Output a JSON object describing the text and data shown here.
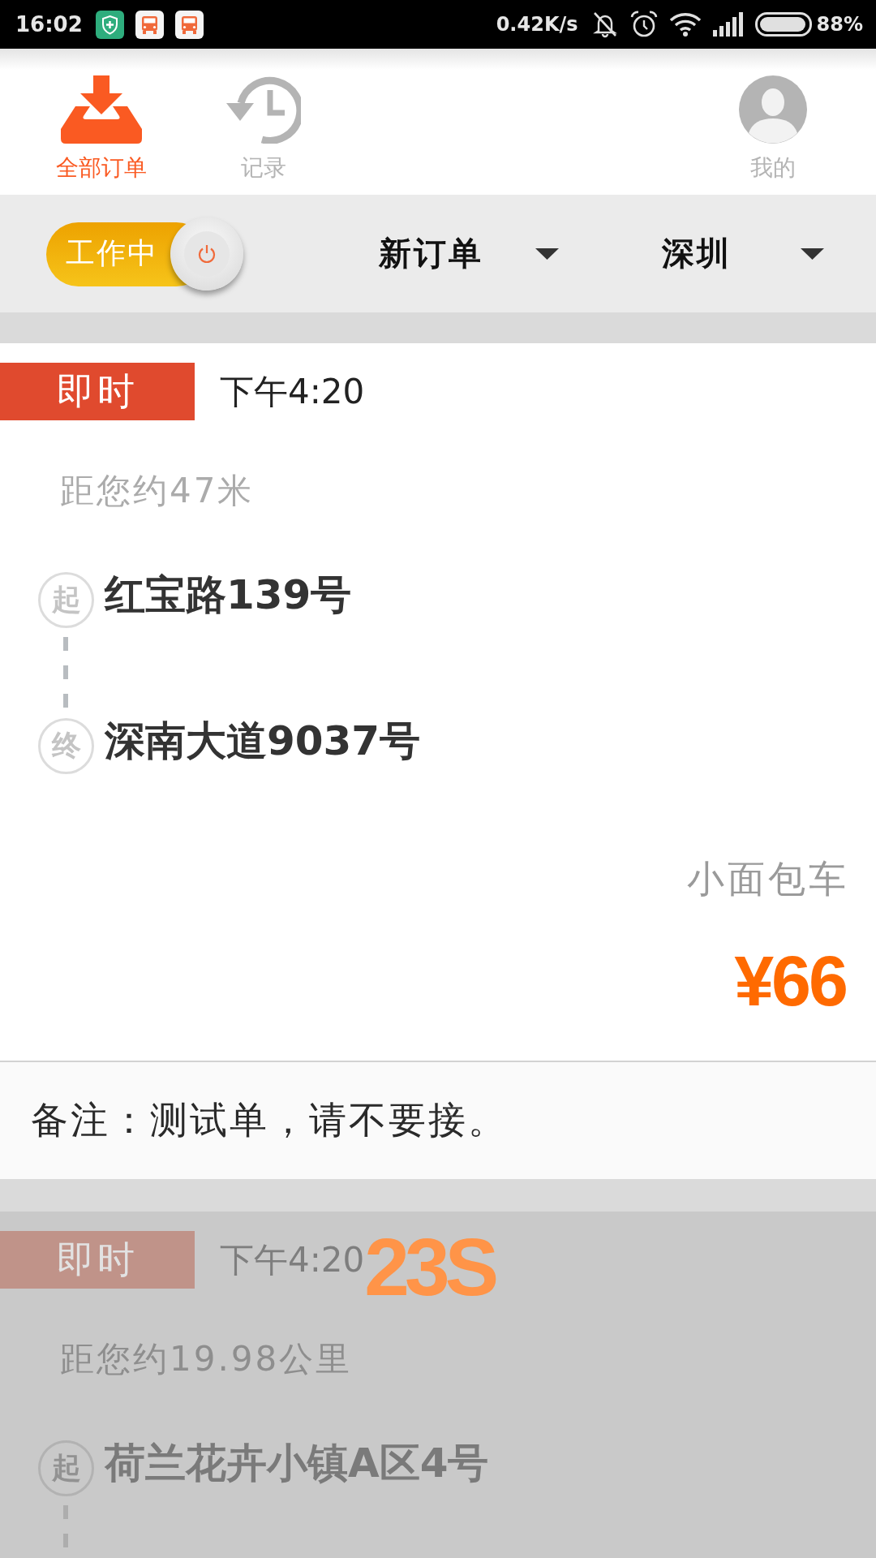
{
  "status_bar": {
    "time": "16:02",
    "network_speed": "0.42K/s",
    "battery": "88%"
  },
  "nav_tabs": [
    {
      "label": "全部订单",
      "selected": true,
      "kind": "inbox"
    },
    {
      "label": "记录",
      "selected": false,
      "kind": "history"
    },
    {
      "label": "我的",
      "selected": false,
      "kind": "profile"
    }
  ],
  "filter_bar": {
    "work_toggle": {
      "label": "工作中",
      "on": true
    },
    "dropdowns": [
      {
        "label": "新订单"
      },
      {
        "label": "深圳"
      }
    ]
  },
  "orders": [
    {
      "tag": "即时",
      "time": "下午4:20",
      "distance": "距您约47米",
      "stops": [
        {
          "marker": "起",
          "address": "红宝路139号"
        },
        {
          "marker": "终",
          "address": "深南大道9037号"
        }
      ],
      "vehicle": "小面包车",
      "price": "¥66",
      "remark": "备注：测试单，请不要接。",
      "dimmed": false
    },
    {
      "tag": "即时",
      "time": "下午4:20",
      "countdown": "23S",
      "distance": "距您约19.98公里",
      "stops": [
        {
          "marker": "起",
          "address": "荷兰花卉小镇A区4号"
        }
      ],
      "dimmed": true
    }
  ]
}
